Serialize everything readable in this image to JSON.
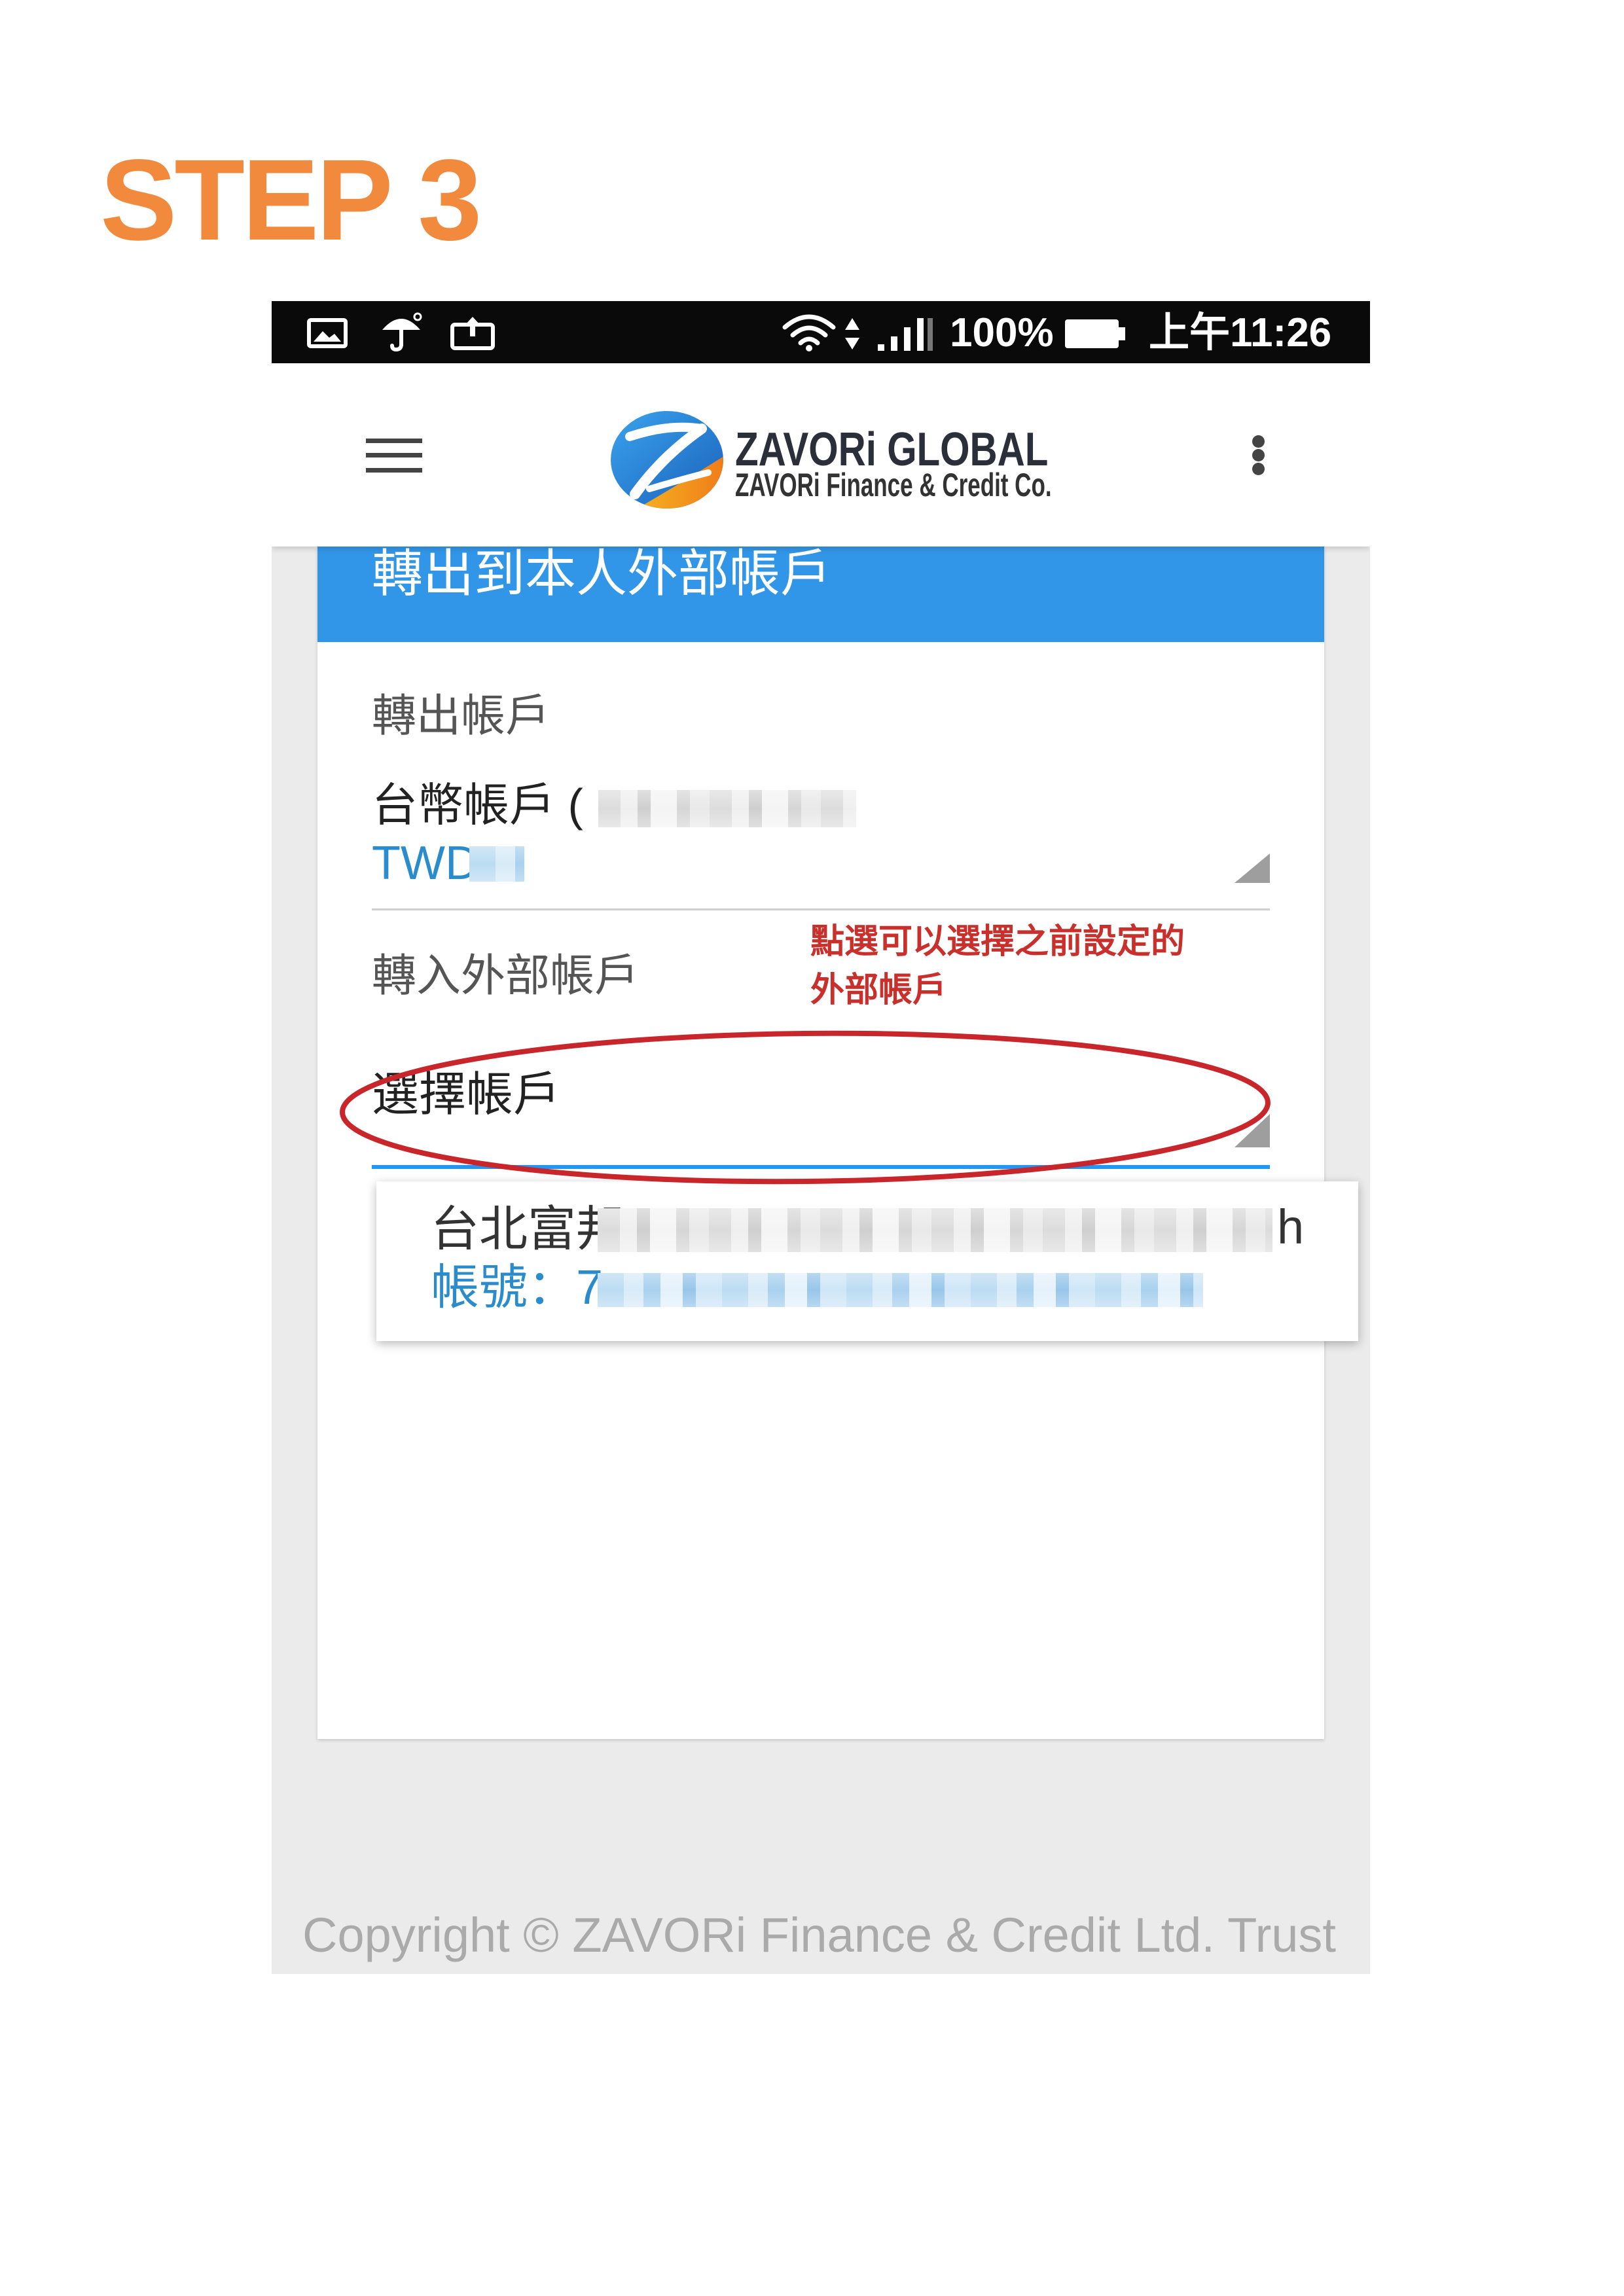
{
  "page": {
    "step_title": "STEP 3"
  },
  "colors": {
    "step_title": "#F18A3D",
    "status_bar_bg": "#0A0A0A",
    "app_bg": "#EBEBEB",
    "card_header_bg": "#3196E8",
    "accent_blue": "#2A8CCC",
    "annotation_red": "#C9302C",
    "footer_text": "#AAAAAA"
  },
  "status_bar": {
    "left_icons": [
      "image-icon",
      "umbrella-icon",
      "briefcase-upload-icon"
    ],
    "right_icons": [
      "wifi-icon",
      "data-arrows-icon",
      "signal-icon",
      "battery-icon"
    ],
    "battery_text": "100%",
    "time": "上午11:26"
  },
  "app_header": {
    "menu_icon": "hamburger-menu-icon",
    "logo_icon": "zavori-logo-icon",
    "brand_name": "ZAVORi GLOBAL",
    "brand_subtitle": "ZAVORi Finance & Credit Co.",
    "more_icon": "more-vertical-icon"
  },
  "transfer_form": {
    "title": "轉出到本人外部帳戶",
    "from_account": {
      "label": "轉出帳戶",
      "name": "台幣帳戶 (",
      "currency": "TWD"
    },
    "to_account": {
      "label": "轉入外部帳戶",
      "placeholder": "選擇帳戶"
    },
    "annotation": {
      "line1": "點選可以選擇之前設定的",
      "line2": "外部帳戶"
    },
    "dropdown_options": [
      {
        "bank_name": "台北富邦",
        "bank_name_tail": "h",
        "account_number": "帳號：7"
      }
    ]
  },
  "footer": {
    "copyright": "Copyright © ZAVORi Finance & Credit Ltd. Trust"
  }
}
